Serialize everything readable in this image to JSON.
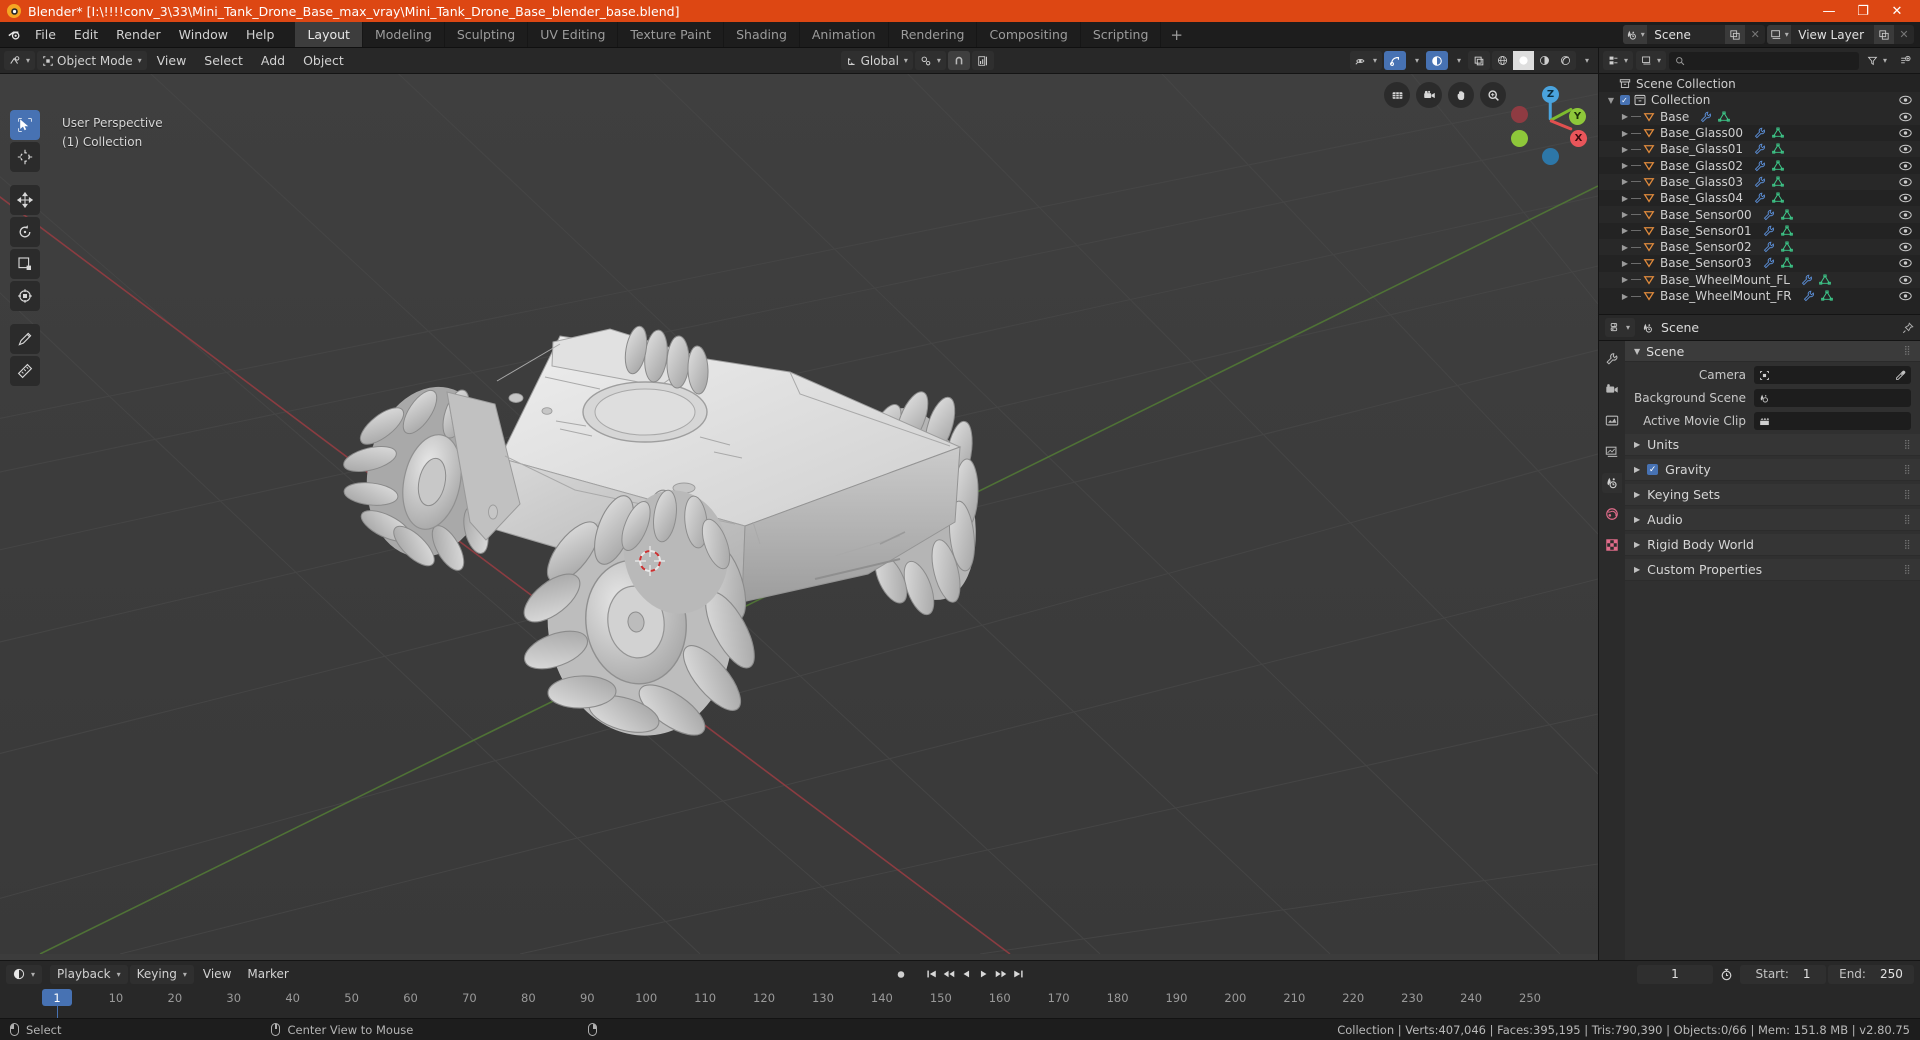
{
  "titlebar": {
    "app_name": "Blender*",
    "file_path": "[I:\\!!!!conv_3\\33\\Mini_Tank_Drone_Base_max_vray\\Mini_Tank_Drone_Base_blender_base.blend]",
    "minimize": "—",
    "maximize": "❐",
    "close": "✕",
    "accent_color": "#dd4713"
  },
  "topbar": {
    "menus": [
      "File",
      "Edit",
      "Render",
      "Window",
      "Help"
    ],
    "workspaces": [
      {
        "label": "Layout",
        "active": true
      },
      {
        "label": "Modeling",
        "active": false
      },
      {
        "label": "Sculpting",
        "active": false
      },
      {
        "label": "UV Editing",
        "active": false
      },
      {
        "label": "Texture Paint",
        "active": false
      },
      {
        "label": "Shading",
        "active": false
      },
      {
        "label": "Animation",
        "active": false
      },
      {
        "label": "Rendering",
        "active": false
      },
      {
        "label": "Compositing",
        "active": false
      },
      {
        "label": "Scripting",
        "active": false
      }
    ],
    "add_workspace": "+",
    "scene_name": "Scene",
    "view_layer_name": "View Layer"
  },
  "viewport": {
    "mode": "Object Mode",
    "menus": [
      "View",
      "Select",
      "Add",
      "Object"
    ],
    "transform_orientation": "Global",
    "overlay_text_line1": "User Perspective",
    "overlay_text_line2": "(1) Collection",
    "gizmo_axes": {
      "x": "X",
      "y": "Y",
      "z": "Z"
    },
    "shading_modes": [
      "wireframe",
      "solid",
      "material-preview",
      "rendered"
    ],
    "active_shading": "solid",
    "tools": [
      {
        "name": "tweak-select-box",
        "active": true
      },
      {
        "name": "cursor",
        "active": false
      },
      {
        "name": "move",
        "active": false
      },
      {
        "name": "rotate",
        "active": false
      },
      {
        "name": "scale",
        "active": false
      },
      {
        "name": "transform",
        "active": false
      },
      {
        "name": "annotate",
        "active": false
      },
      {
        "name": "measure",
        "active": false
      }
    ],
    "nav_buttons": [
      "grid-toggle",
      "camera-view",
      "pan-view",
      "zoom-view"
    ]
  },
  "outliner": {
    "display_mode": "View Layer",
    "search_placeholder": "",
    "root": "Scene Collection",
    "collection": "Collection",
    "items": [
      {
        "label": "Base",
        "type": "mesh"
      },
      {
        "label": "Base_Glass00",
        "type": "mesh"
      },
      {
        "label": "Base_Glass01",
        "type": "mesh"
      },
      {
        "label": "Base_Glass02",
        "type": "mesh"
      },
      {
        "label": "Base_Glass03",
        "type": "mesh"
      },
      {
        "label": "Base_Glass04",
        "type": "mesh"
      },
      {
        "label": "Base_Sensor00",
        "type": "mesh"
      },
      {
        "label": "Base_Sensor01",
        "type": "mesh"
      },
      {
        "label": "Base_Sensor02",
        "type": "mesh"
      },
      {
        "label": "Base_Sensor03",
        "type": "mesh"
      },
      {
        "label": "Base_WheelMount_FL",
        "type": "mesh"
      },
      {
        "label": "Base_WheelMount_FR",
        "type": "mesh"
      }
    ]
  },
  "properties": {
    "breadcrumb": "Scene",
    "panel_title": "Scene",
    "rows": [
      {
        "label": "Camera",
        "value": "",
        "icon": "camera-data-icon"
      },
      {
        "label": "Background Scene",
        "value": "",
        "icon": "scene-icon"
      },
      {
        "label": "Active Movie Clip",
        "value": "",
        "icon": "clip-icon"
      }
    ],
    "sections": [
      {
        "label": "Units",
        "checkbox": false
      },
      {
        "label": "Gravity",
        "checkbox": true
      },
      {
        "label": "Keying Sets",
        "checkbox": false
      },
      {
        "label": "Audio",
        "checkbox": false
      },
      {
        "label": "Rigid Body World",
        "checkbox": false
      },
      {
        "label": "Custom Properties",
        "checkbox": false
      }
    ]
  },
  "timeline": {
    "editor_type": "timeline",
    "menus": [
      "Playback",
      "Keying",
      "View",
      "Marker"
    ],
    "current_frame": "1",
    "start_label": "Start:",
    "start_value": "1",
    "end_label": "End:",
    "end_value": "250",
    "ruler_ticks": [
      "10",
      "20",
      "30",
      "40",
      "50",
      "60",
      "70",
      "80",
      "90",
      "100",
      "110",
      "120",
      "130",
      "140",
      "150",
      "160",
      "170",
      "180",
      "190",
      "200",
      "210",
      "220",
      "230",
      "240",
      "250"
    ],
    "playhead_label": "1"
  },
  "statusbar": {
    "left_action": "Select",
    "mid_action": "Center View to Mouse",
    "stats": "Collection | Verts:407,046 | Faces:395,195 | Tris:790,390 | Objects:0/66 | Mem: 151.8 MB | v2.80.75"
  }
}
